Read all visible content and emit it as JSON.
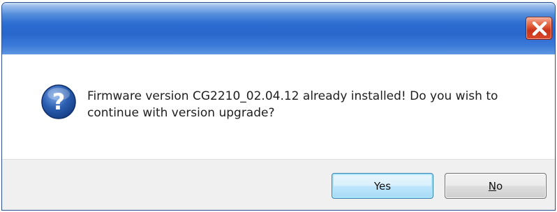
{
  "dialog": {
    "title": "",
    "message": "Firmware version CG2210_02.04.12 already installed! Do you wish to continue with version upgrade?",
    "icon": "question-icon",
    "close_icon": "close-icon"
  },
  "buttons": {
    "yes_label": "Yes",
    "no_mnemonic": "N",
    "no_rest": "o"
  },
  "colors": {
    "titlebar": "#2b6bd0",
    "close_button": "#d9482a",
    "footer": "#f0f0f0",
    "icon": "#2a5db0"
  }
}
